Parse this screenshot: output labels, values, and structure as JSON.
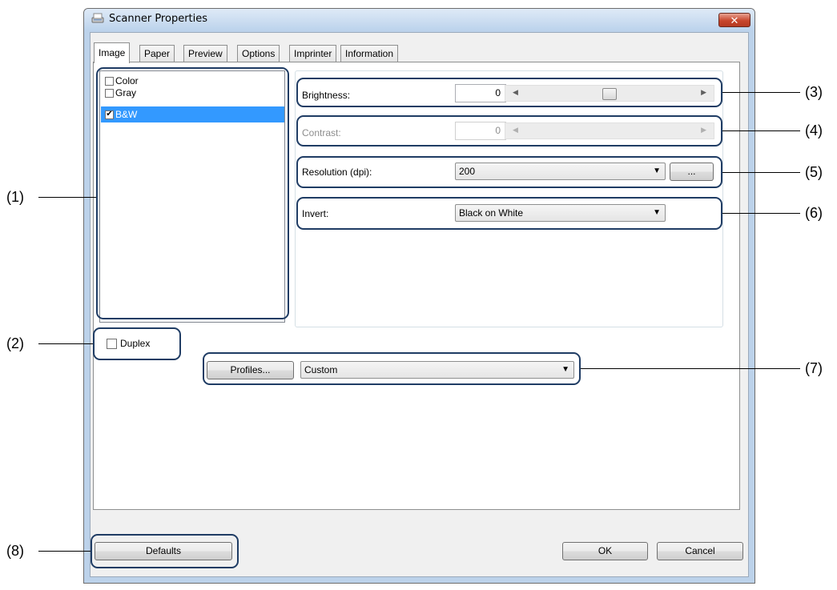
{
  "window": {
    "title": "Scanner Properties",
    "close_glyph": "✕"
  },
  "tabs": [
    {
      "label": "Image",
      "active": true
    },
    {
      "label": "Paper",
      "active": false
    },
    {
      "label": "Preview",
      "active": false
    },
    {
      "label": "Options",
      "active": false
    },
    {
      "label": "Imprinter",
      "active": false
    },
    {
      "label": "Information",
      "active": false
    }
  ],
  "color_modes": [
    {
      "label": "Color",
      "checked": false,
      "selected": false
    },
    {
      "label": "Gray",
      "checked": false,
      "selected": false
    },
    {
      "label": "B&W",
      "checked": true,
      "selected": true
    }
  ],
  "brightness": {
    "label": "Brightness:",
    "value": "0",
    "slider_fraction": 0.5
  },
  "contrast": {
    "label": "Contrast:",
    "value": "0",
    "enabled": false
  },
  "resolution": {
    "label": "Resolution (dpi):",
    "value": "200",
    "more_button": "..."
  },
  "invert": {
    "label": "Invert:",
    "value": "Black on White"
  },
  "duplex": {
    "label": "Duplex",
    "checked": false
  },
  "profiles": {
    "button": "Profiles...",
    "value": "Custom"
  },
  "buttons": {
    "defaults": "Defaults",
    "ok": "OK",
    "cancel": "Cancel"
  },
  "callouts": {
    "c1": "(1)",
    "c2": "(2)",
    "c3": "(3)",
    "c4": "(4)",
    "c5": "(5)",
    "c6": "(6)",
    "c7": "(7)",
    "c8": "(8)"
  },
  "icons": {
    "window": "scanner-icon",
    "checkmark": "✔",
    "dropdown": "▼",
    "arrow_left": "◀",
    "arrow_right": "▶"
  }
}
